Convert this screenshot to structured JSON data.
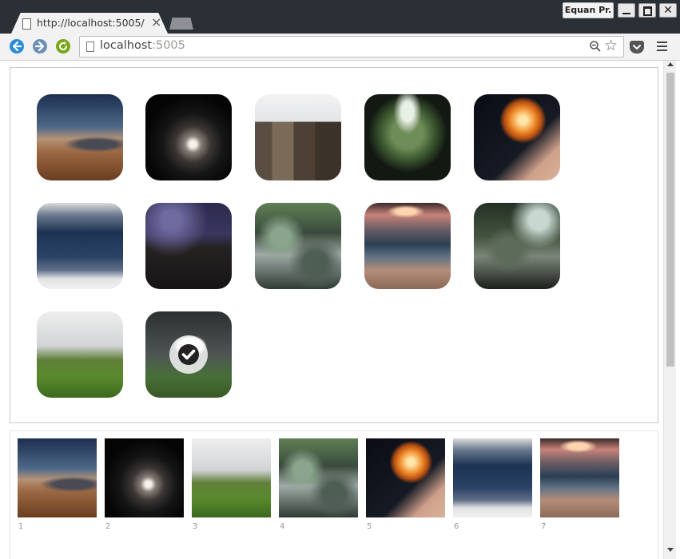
{
  "browser": {
    "tab_title": "http://localhost:5005/",
    "tab_close_glyph": "×",
    "profile_name": "Equan Pr.",
    "close_glyph": "✕",
    "url_host": "localhost",
    "url_port": ":5005",
    "star_glyph": "☆"
  },
  "icons": {
    "back": "back-arrow-icon",
    "forward": "forward-arrow-icon",
    "reload": "reload-icon",
    "zoom": "zoom-out-icon",
    "star": "bookmark-star-icon",
    "pocket": "pocket-icon",
    "menu": "hamburger-menu-icon",
    "check": "checkmark-icon"
  },
  "colors": {
    "back": "#2a8cd8",
    "forward": "#6d8fb5",
    "reload": "#7aa61a",
    "chrome_dark": "#2b2f36"
  },
  "gallery": {
    "images": [
      {
        "subject": "bromo-volcano",
        "selected": false
      },
      {
        "subject": "moon-night",
        "selected": false
      },
      {
        "subject": "temple-ruins-day",
        "selected": false
      },
      {
        "subject": "forest-tree",
        "selected": false
      },
      {
        "subject": "sky-lantern",
        "selected": false
      },
      {
        "subject": "volcano-above-clouds",
        "selected": false
      },
      {
        "subject": "temple-starry-night",
        "selected": false
      },
      {
        "subject": "waterfall-rocks",
        "selected": false
      },
      {
        "subject": "sunset-beach",
        "selected": false
      },
      {
        "subject": "mossy-rocks-falls",
        "selected": false
      },
      {
        "subject": "tea-plantation",
        "selected": false
      },
      {
        "subject": "goats-meadow",
        "selected": true
      }
    ]
  },
  "selection": {
    "items": [
      {
        "label": "1",
        "subject": "bromo-volcano"
      },
      {
        "label": "2",
        "subject": "moon-night"
      },
      {
        "label": "3",
        "subject": "tea-plantation"
      },
      {
        "label": "4",
        "subject": "waterfall-rocks"
      },
      {
        "label": "5",
        "subject": "sky-lantern"
      },
      {
        "label": "6",
        "subject": "volcano-above-clouds"
      },
      {
        "label": "7",
        "subject": "sunset-beach"
      }
    ]
  }
}
